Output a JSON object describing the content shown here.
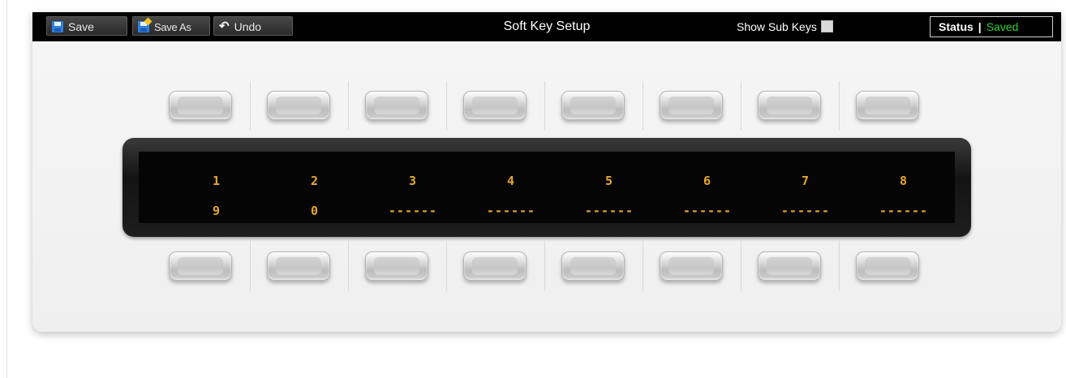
{
  "toolbar": {
    "save_label": "Save",
    "save_as_label": "Save As",
    "undo_label": "Undo",
    "title": "Soft Key Setup",
    "show_sub_keys_label": "Show Sub Keys",
    "show_sub_keys_checked": false,
    "status_label": "Status",
    "status_separator": "|",
    "status_value": "Saved",
    "status_value_color": "#2bd12b",
    "icons": {
      "save": "floppy-disk-icon",
      "save_as": "floppy-disk-star-icon",
      "undo": "undo-arrow-icon"
    }
  },
  "display": {
    "top_row": [
      "1",
      "2",
      "3",
      "4",
      "5",
      "6",
      "7",
      "8"
    ],
    "bottom_row": [
      "9",
      "0",
      "------",
      "------",
      "------",
      "------",
      "------",
      "------"
    ],
    "text_color": "#e8a62e"
  },
  "keys": {
    "top_count": 8,
    "bottom_count": 8
  }
}
